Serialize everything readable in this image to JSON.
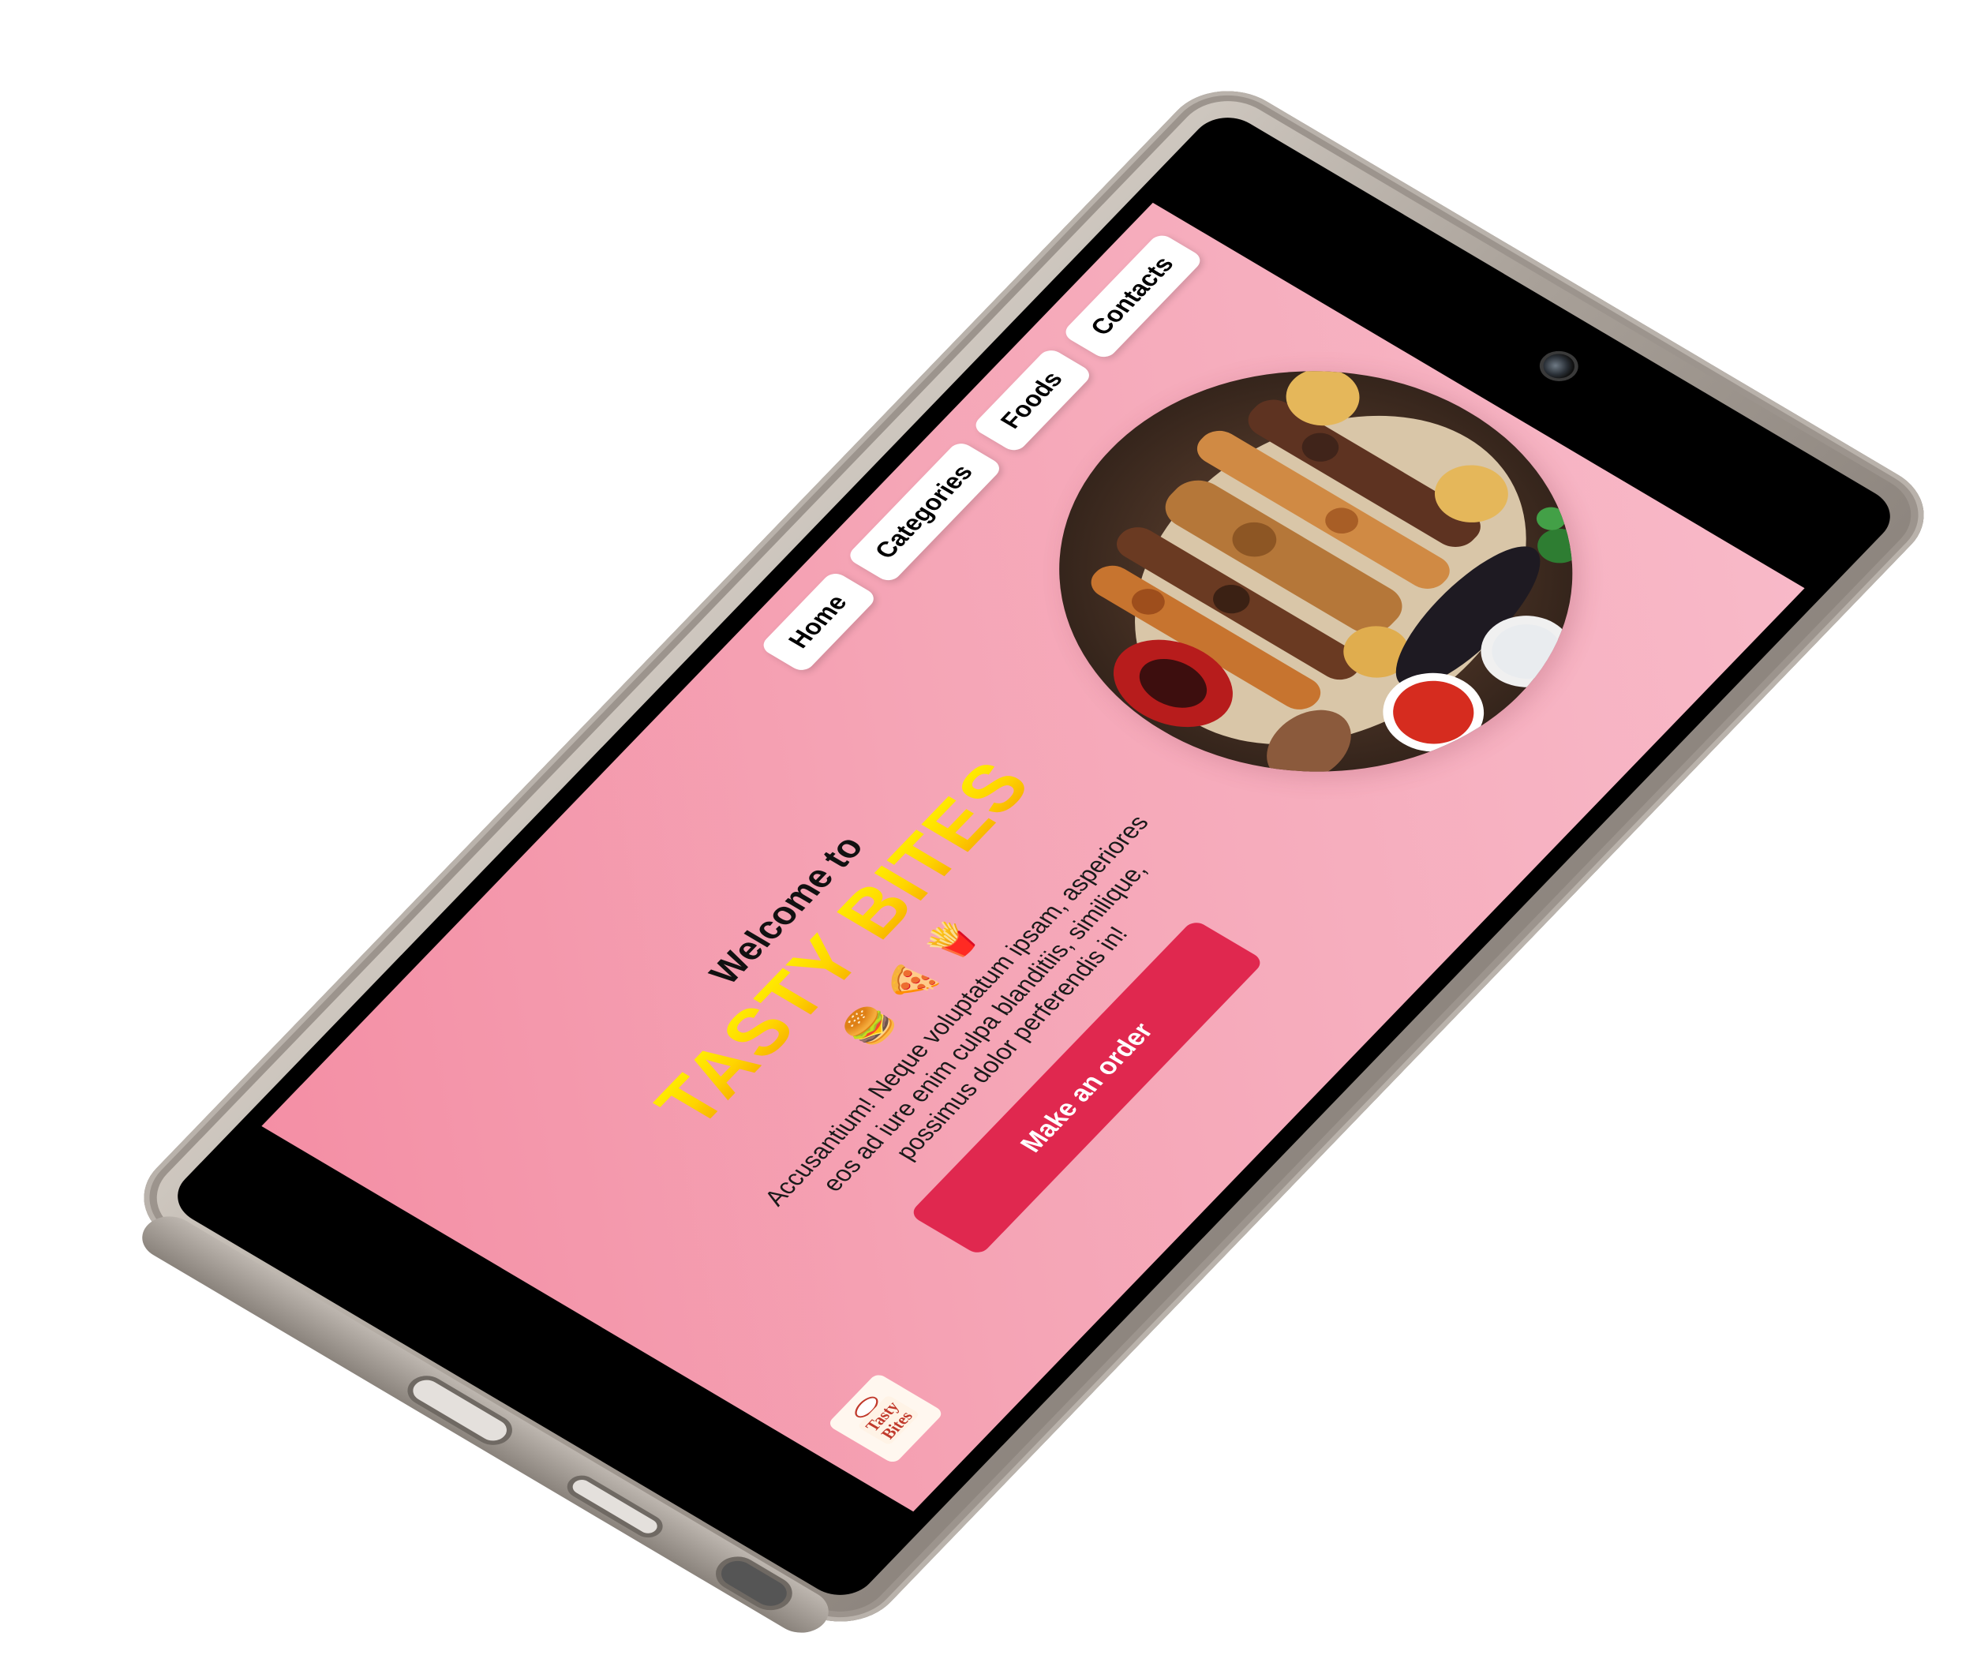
{
  "nav": {
    "items": [
      {
        "label": "Home"
      },
      {
        "label": "Categories"
      },
      {
        "label": "Foods"
      },
      {
        "label": "Contacts"
      }
    ]
  },
  "hero": {
    "welcome": "Welcome to",
    "brand": "TASTY BITES",
    "emojis": [
      "🍔",
      "🍕",
      "🍟"
    ],
    "description": "Accusantium! Neque voluptatum ipsam, asperiores eos ad iure enim culpa blanditiis, similique, possimus dolor perferendis in!",
    "cta_label": "Make an order",
    "image_alt": "food-platter-image"
  },
  "logo": {
    "text_top": "Tasty",
    "text_bottom": "Bites"
  },
  "colors": {
    "background_start": "#f48fa5",
    "background_end": "#f8b9c8",
    "brand_yellow": "#ffd400",
    "cta": "#e0284f",
    "phone_frame": "#a9a199"
  }
}
